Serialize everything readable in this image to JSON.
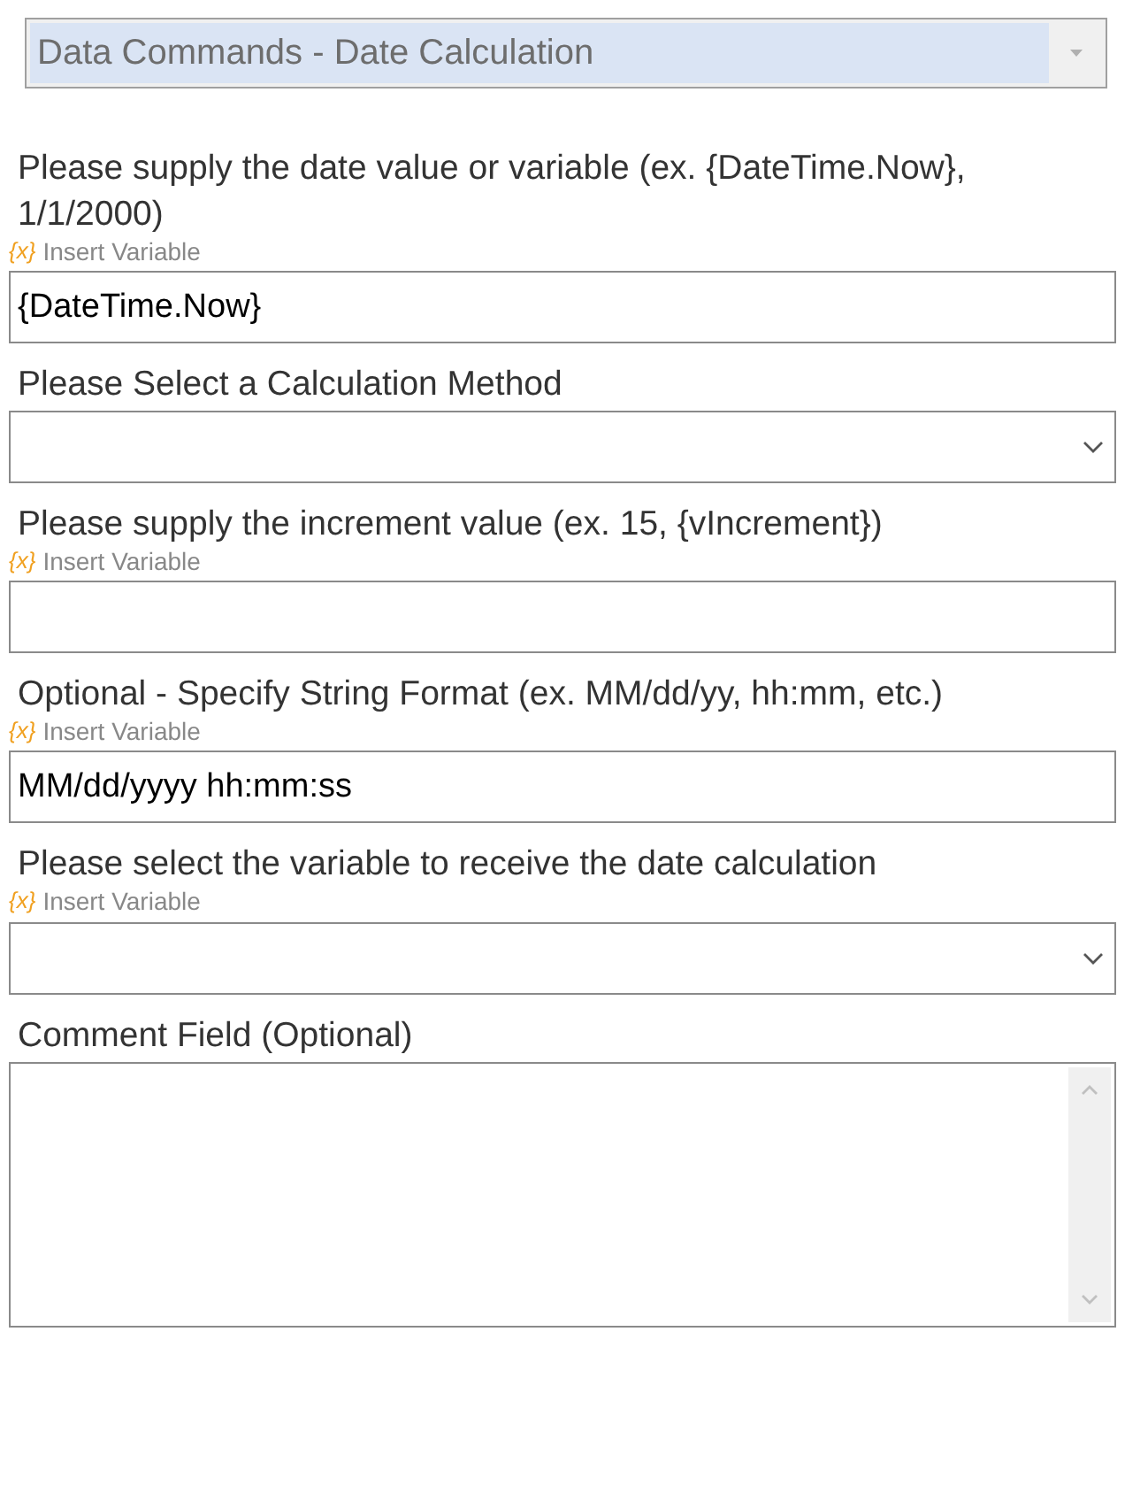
{
  "command_select": {
    "value": "Data Commands - Date Calculation",
    "disabled": true
  },
  "fields": [
    {
      "kind": "text",
      "label": "Please supply the date value or variable (ex. {DateTime.Now}, 1/1/2000)",
      "insert_variable": {
        "icon": "{x}",
        "label": "Insert Variable"
      },
      "value": "{DateTime.Now}"
    },
    {
      "kind": "select",
      "label": "Please Select a Calculation Method"
    },
    {
      "kind": "text",
      "label": "Please supply the increment value (ex. 15, {vIncrement})",
      "insert_variable": {
        "icon": "{x}",
        "label": "Insert Variable"
      }
    },
    {
      "kind": "text",
      "label": "Optional - Specify String Format (ex. MM/dd/yy, hh:mm, etc.)",
      "insert_variable": {
        "icon": "{x}",
        "label": "Insert Variable"
      },
      "value": "MM/dd/yyyy hh:mm:ss"
    },
    {
      "kind": "select",
      "label": "Please select the variable to receive the date calculation",
      "insert_variable": {
        "icon": "{x}",
        "label": "Insert Variable"
      }
    },
    {
      "kind": "textarea",
      "label": "Comment Field (Optional)"
    }
  ]
}
